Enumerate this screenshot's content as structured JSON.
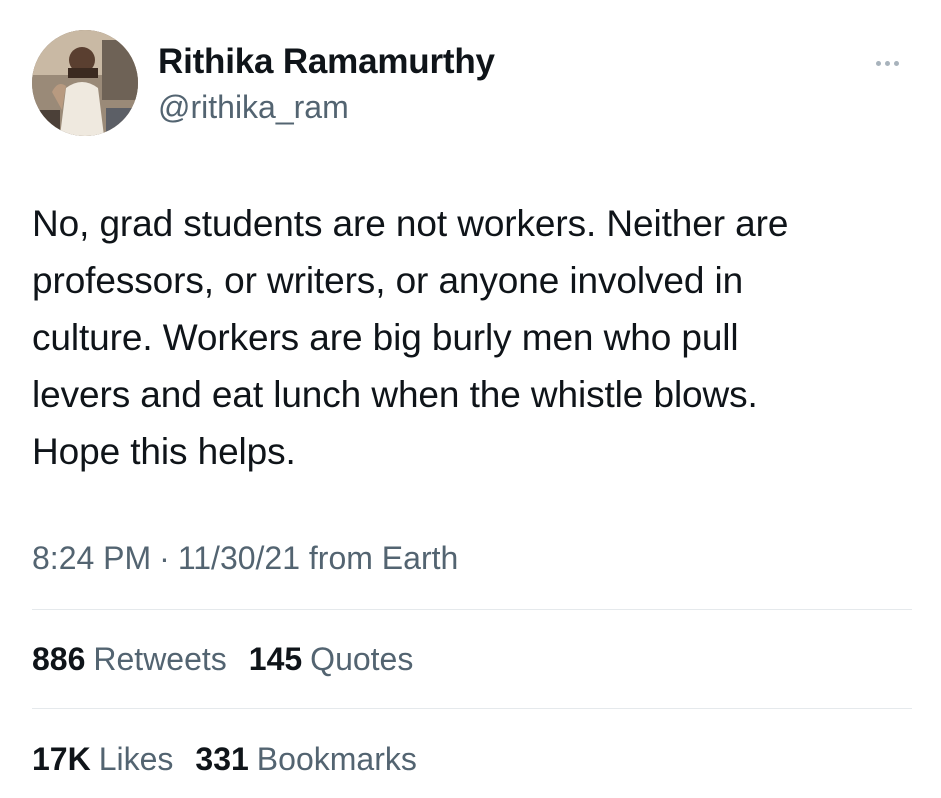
{
  "author": {
    "display_name": "Rithika Ramamurthy",
    "handle": "@rithika_ram",
    "avatar_icon": "profile-photo"
  },
  "more_icon": "ellipsis-icon",
  "tweet": {
    "text": "No, grad students are not workers. Neither are\nprofessors, or writers, or anyone involved in\nculture. Workers are big burly men who pull\nlevers and eat lunch when the whistle blows.\nHope this helps."
  },
  "meta": {
    "time": "8:24 PM",
    "separator": "·",
    "date": "11/30/21",
    "source": "from Earth"
  },
  "stats": {
    "retweets": {
      "count": "886",
      "label": "Retweets"
    },
    "quotes": {
      "count": "145",
      "label": "Quotes"
    },
    "likes": {
      "count": "17K",
      "label": "Likes"
    },
    "bookmarks": {
      "count": "331",
      "label": "Bookmarks"
    }
  },
  "colors": {
    "text_primary": "#0f1419",
    "text_secondary": "#536471",
    "divider": "#e5e9ec"
  }
}
